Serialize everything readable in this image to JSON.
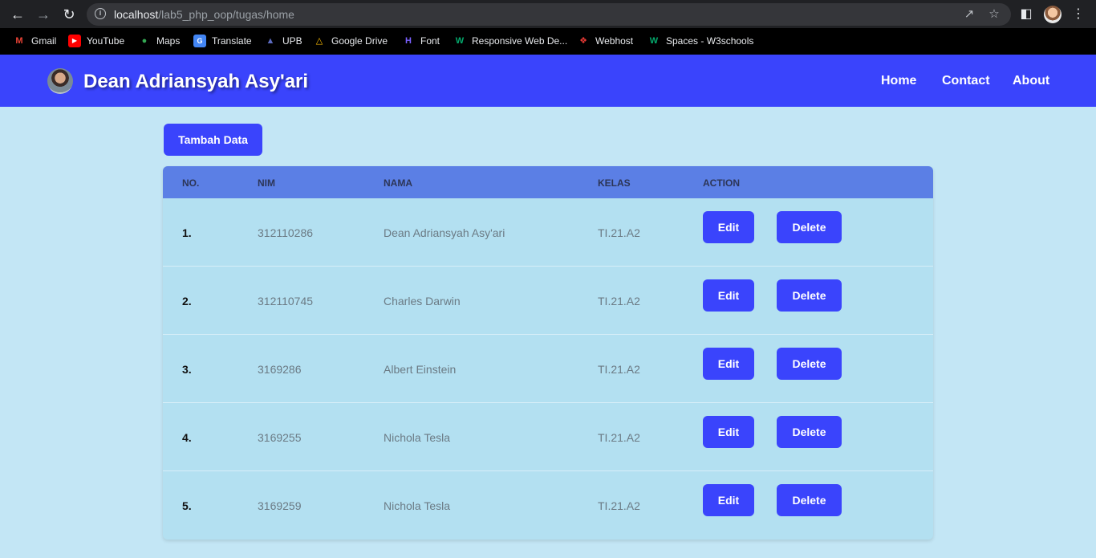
{
  "browser": {
    "url_host": "localhost",
    "url_path": "/lab5_php_oop/tugas/home",
    "bookmarks": [
      {
        "label": "Gmail",
        "icon": "gmail-icon",
        "color": "#ea4335"
      },
      {
        "label": "YouTube",
        "icon": "youtube-icon",
        "color": "#ff0000"
      },
      {
        "label": "Maps",
        "icon": "maps-icon",
        "color": "#34a853"
      },
      {
        "label": "Translate",
        "icon": "translate-icon",
        "color": "#4285f4"
      },
      {
        "label": "UPB",
        "icon": "upb-icon",
        "color": "#1a237e"
      },
      {
        "label": "Google Drive",
        "icon": "drive-icon",
        "color": "#fbbc04"
      },
      {
        "label": "Font",
        "icon": "font-icon",
        "color": "#7b61ff"
      },
      {
        "label": "Responsive Web De...",
        "icon": "w3schools-icon",
        "color": "#04aa6d"
      },
      {
        "label": "Webhost",
        "icon": "webhost-icon",
        "color": "#e53935"
      },
      {
        "label": "Spaces - W3schools",
        "icon": "w3schools-icon",
        "color": "#04aa6d"
      }
    ]
  },
  "header": {
    "title": "Dean Adriansyah Asy'ari",
    "nav": [
      "Home",
      "Contact",
      "About"
    ]
  },
  "main": {
    "add_button": "Tambah Data",
    "columns": [
      "NO.",
      "NIM",
      "NAMA",
      "KELAS",
      "ACTION"
    ],
    "edit_label": "Edit",
    "delete_label": "Delete",
    "rows": [
      {
        "no": "1.",
        "nim": "312110286",
        "nama": "Dean Adriansyah Asy'ari",
        "kelas": "TI.21.A2"
      },
      {
        "no": "2.",
        "nim": "312110745",
        "nama": "Charles Darwin",
        "kelas": "TI.21.A2"
      },
      {
        "no": "3.",
        "nim": "3169286",
        "nama": "Albert Einstein",
        "kelas": "TI.21.A2"
      },
      {
        "no": "4.",
        "nim": "3169255",
        "nama": "Nichola Tesla",
        "kelas": "TI.21.A2"
      },
      {
        "no": "5.",
        "nim": "3169259",
        "nama": "Nichola Tesla",
        "kelas": "TI.21.A2"
      }
    ]
  },
  "colors": {
    "accent": "#3a44fc",
    "page_bg": "#c3e6f5",
    "table_header": "#5b7fe5",
    "table_body": "#b3e0f1"
  }
}
